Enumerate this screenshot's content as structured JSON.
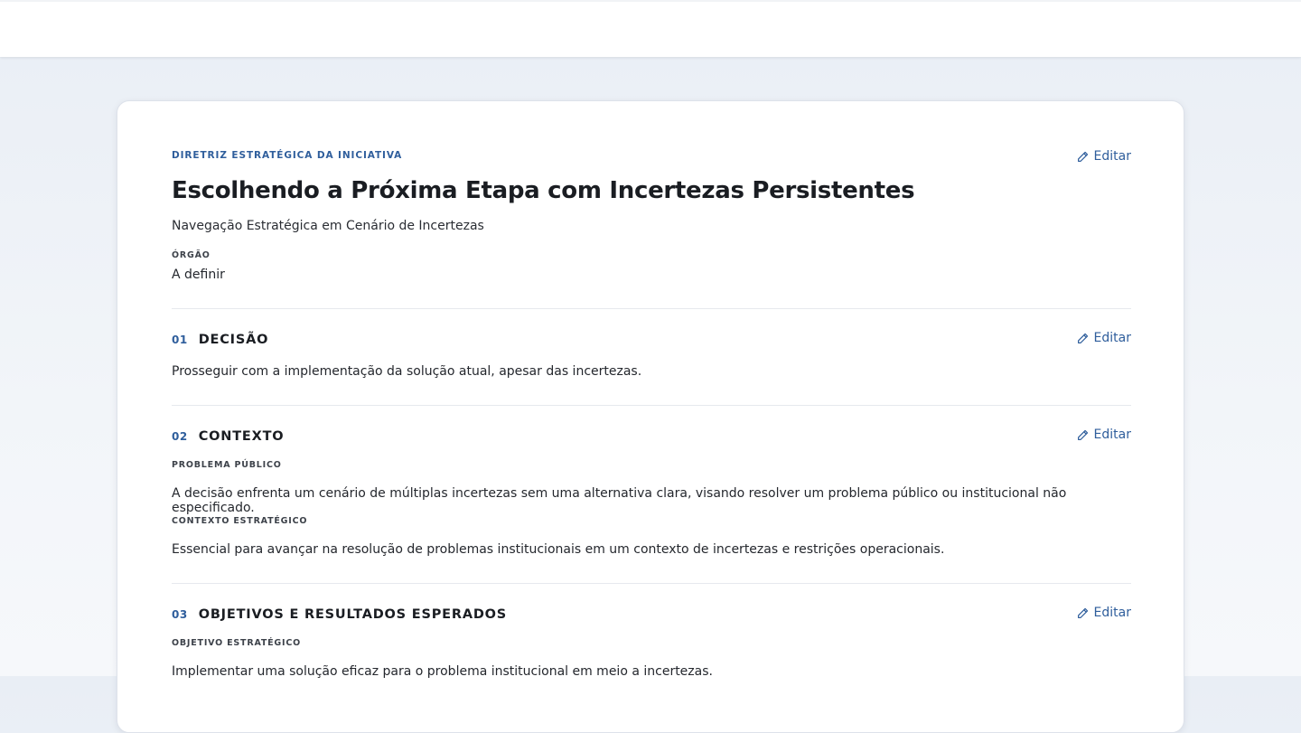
{
  "header": {
    "overline": "DIRETRIZ ESTRATÉGICA DA INICIATIVA",
    "title": "Escolhendo a Próxima Etapa com Incertezas Persistentes",
    "subtitle": "Navegação Estratégica em Cenário de Incertezas",
    "orgao_label": "ÓRGÃO",
    "orgao_value": "A definir",
    "edit_label": "Editar"
  },
  "sections": [
    {
      "number": "01",
      "title": "DECISÃO",
      "edit_label": "Editar",
      "text": "Prosseguir com a implementação da solução atual, apesar das incertezas."
    },
    {
      "number": "02",
      "title": "CONTEXTO",
      "edit_label": "Editar",
      "fields": [
        {
          "label": "PROBLEMA PÚBLICO",
          "text": "A decisão enfrenta um cenário de múltiplas incertezas sem uma alternativa clara, visando resolver um problema público ou institucional não especificado."
        },
        {
          "label": "CONTEXTO ESTRATÉGICO",
          "text": "Essencial para avançar na resolução de problemas institucionais em um contexto de incertezas e restrições operacionais."
        }
      ]
    },
    {
      "number": "03",
      "title": "OBJETIVOS E RESULTADOS ESPERADOS",
      "edit_label": "Editar",
      "fields": [
        {
          "label": "OBJETIVO ESTRATÉGICO",
          "text": "Implementar uma solução eficaz para o problema institucional em meio a incertezas."
        }
      ]
    }
  ],
  "colors": {
    "accent": "#2f5e9c",
    "text": "#1f2227",
    "divider": "#e6e9ee"
  },
  "icons": {
    "edit": "pencil-icon"
  }
}
